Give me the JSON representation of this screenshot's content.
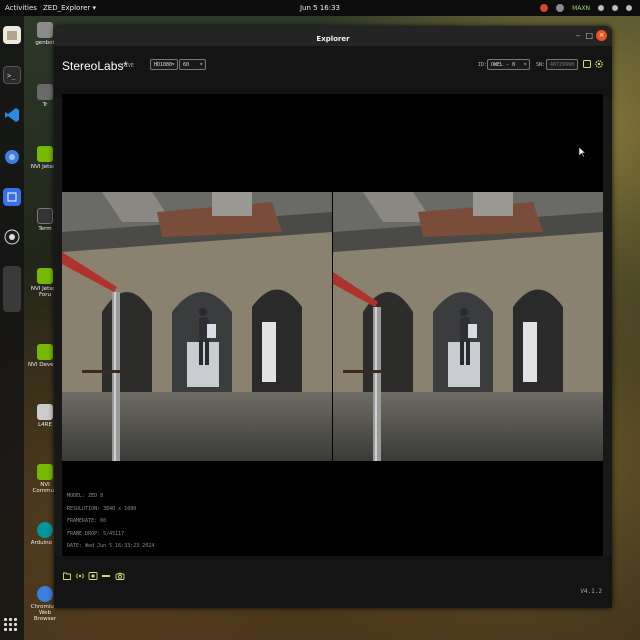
{
  "topbar": {
    "activities": "Activities",
    "app_menu": "ZED_Explorer ▾",
    "clock": "Jun 5  16:33",
    "power_mode": "MAXN"
  },
  "desktop": {
    "icons": [
      {
        "label": "genbot"
      },
      {
        "label": "Tr"
      },
      {
        "label": "NVI Jetson"
      },
      {
        "label": "Term"
      },
      {
        "label": "NVI Jetson Foru"
      },
      {
        "label": "NVI Develop"
      },
      {
        "label": "L4RE"
      },
      {
        "label": "NVI Commun"
      },
      {
        "label": "Arduino IC"
      },
      {
        "label": "Chromium Web Browser"
      }
    ]
  },
  "window": {
    "title": "Explorer",
    "minimize": "–",
    "maximize": "□",
    "close": "×"
  },
  "toolbar": {
    "logo": "StereoLabs*",
    "mode": "LIVE",
    "resolution": "HD1080",
    "fps": "60",
    "id_label": "ID:",
    "device": "OWEL - 0",
    "sn_label": "SN:",
    "serial": "40729998"
  },
  "info": {
    "model": "MODEL: ZED 8",
    "resolution": "RESOLUTION: 3840 x 1080",
    "framerate": "FRAMERATE: 60",
    "frame_drop": "FRAME DROP: 5/45117",
    "date": "DATE: Wed Jun 5 16:33:23 2024"
  },
  "footer": {
    "version": "V4.1.2"
  },
  "icons": {
    "folder": "folder-icon",
    "stream": "stream-icon",
    "record": "record-icon",
    "snapshot": "camera-icon",
    "settings": "gear-icon",
    "fullscreen": "fullscreen-icon"
  },
  "colors": {
    "accent": "#c9e26a",
    "close": "#e95420"
  }
}
